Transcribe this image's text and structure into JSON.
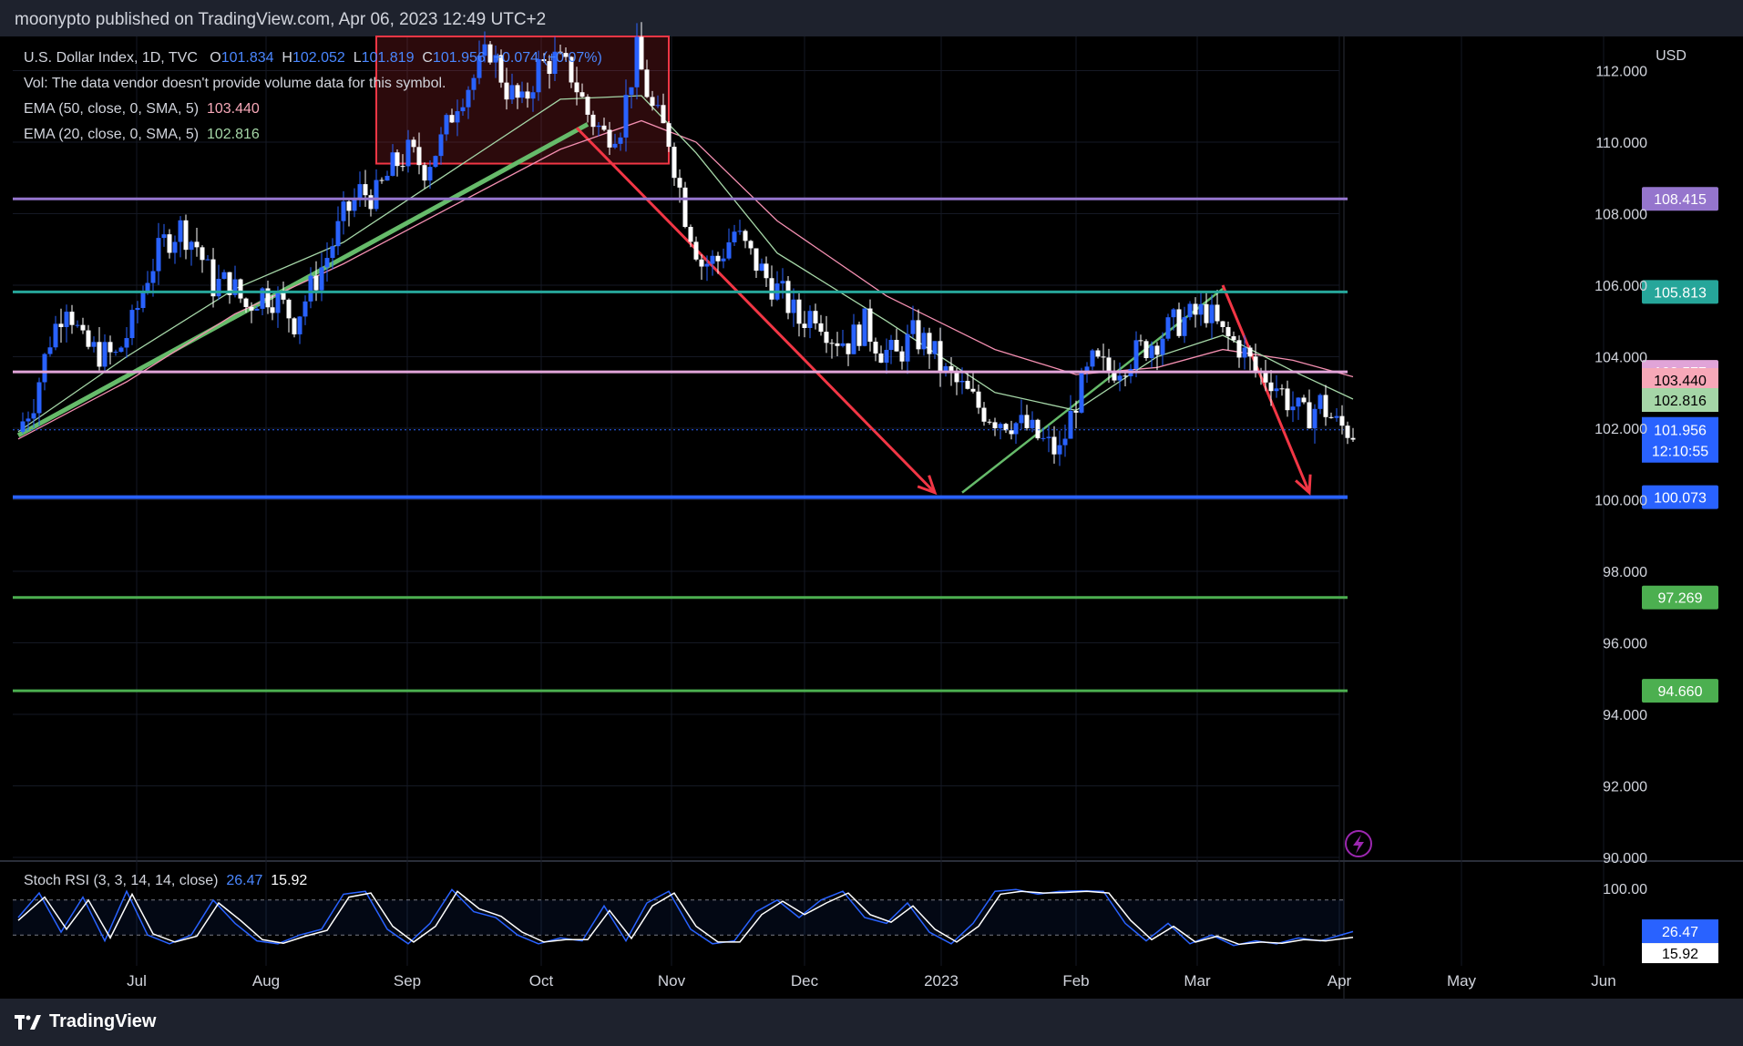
{
  "header": {
    "publisher": "moonypto published on TradingView.com, Apr 06, 2023 12:49 UTC+2"
  },
  "legend": {
    "symbol": "U.S. Dollar Index, 1D, TVC",
    "open_label": "O",
    "open": "101.834",
    "high_label": "H",
    "high": "102.052",
    "low_label": "L",
    "low": "101.819",
    "close_label": "C",
    "close": "101.956",
    "change": "+0.074 (+0.07%)",
    "vol_note": "Vol: The data vendor doesn't provide volume data for this symbol.",
    "ema50_label": "EMA (50, close, 0, SMA, 5)",
    "ema50_value": "103.440",
    "ema20_label": "EMA (20, close, 0, SMA, 5)",
    "ema20_value": "102.816"
  },
  "rsi": {
    "label": "Stoch RSI (3, 3, 14, 14, close)",
    "k_value": "26.47",
    "d_value": "15.92"
  },
  "footer": {
    "brand": "TradingView"
  },
  "colors": {
    "background": "#000000",
    "up": "#2962ff",
    "down": "#ffffff",
    "ema50": "#f48fb1",
    "ema20": "#a5d6a7",
    "stoch_k": "#2962ff",
    "stoch_d": "#ffffff",
    "level_purple": "#9575cd",
    "level_teal": "#26a69a",
    "level_pink": "#e1a4d8",
    "level_blue": "#2962ff",
    "level_green": "#4caf50",
    "arrow_red": "#f23645",
    "trend_green": "#66bb6a",
    "box_red": "#f23645"
  },
  "chart_data": {
    "type": "candlestick",
    "title": "U.S. Dollar Index, 1D, TVC",
    "currency": "USD",
    "y_ticks": [
      "112.000",
      "110.000",
      "108.000",
      "106.000",
      "104.000",
      "102.000",
      "100.000",
      "98.000",
      "96.000",
      "94.000",
      "92.000",
      "90.000"
    ],
    "y_tick_values": [
      112,
      110,
      108,
      106,
      104,
      102,
      100,
      98,
      96,
      94,
      92,
      90
    ],
    "ylim": [
      90,
      113
    ],
    "x_labels": [
      "Jul",
      "Aug",
      "Sep",
      "Oct",
      "Nov",
      "Dec",
      "2023",
      "Feb",
      "Mar",
      "Apr",
      "May",
      "Jun"
    ],
    "horizontal_levels": [
      {
        "value": 108.415,
        "label": "108.415",
        "color": "#9575cd"
      },
      {
        "value": 105.813,
        "label": "105.813",
        "color": "#26a69a"
      },
      {
        "value": 103.577,
        "label": "103.577",
        "color": "#e1a4d8"
      },
      {
        "value": 100.073,
        "label": "100.073",
        "color": "#2962ff"
      },
      {
        "value": 97.269,
        "label": "97.269",
        "color": "#4caf50"
      },
      {
        "value": 94.66,
        "label": "94.660",
        "color": "#4caf50"
      }
    ],
    "price_badges": [
      {
        "label": "103.440",
        "color": "#f7a8b8"
      },
      {
        "label": "102.816",
        "color": "#a5d6a7"
      },
      {
        "label": "101.956",
        "color": "#2962ff"
      },
      {
        "label": "12:10:55",
        "color": "#2962ff"
      }
    ],
    "last_price": 101.956,
    "countdown": "12:10:55",
    "ema50_last": 103.44,
    "ema20_last": 102.816,
    "rsi_ticks": [
      "100.00"
    ],
    "rsi_k_last": 26.47,
    "rsi_d_last": 15.92,
    "close_path": [
      [
        0,
        101.9
      ],
      [
        3,
        102.8
      ],
      [
        6,
        104.5
      ],
      [
        9,
        105.6
      ],
      [
        12,
        104.3
      ],
      [
        15,
        104.1
      ],
      [
        18,
        104.0
      ],
      [
        21,
        104.9
      ],
      [
        24,
        106.3
      ],
      [
        27,
        107.2
      ],
      [
        30,
        107.6
      ],
      [
        33,
        107.1
      ],
      [
        36,
        106.0
      ],
      [
        39,
        106.1
      ],
      [
        42,
        105.4
      ],
      [
        45,
        105.8
      ],
      [
        48,
        105.6
      ],
      [
        51,
        105.0
      ],
      [
        54,
        105.9
      ],
      [
        57,
        106.8
      ],
      [
        60,
        107.9
      ],
      [
        63,
        108.6
      ],
      [
        66,
        108.5
      ],
      [
        69,
        109.3
      ],
      [
        72,
        109.7
      ],
      [
        75,
        109.3
      ],
      [
        78,
        110.0
      ],
      [
        81,
        111.2
      ],
      [
        84,
        111.8
      ],
      [
        87,
        112.6
      ],
      [
        90,
        111.5
      ],
      [
        93,
        111.0
      ],
      [
        96,
        112.1
      ],
      [
        99,
        112.3
      ],
      [
        102,
        111.9
      ],
      [
        105,
        110.8
      ],
      [
        108,
        110.2
      ],
      [
        111,
        110.5
      ],
      [
        114,
        112.5
      ],
      [
        117,
        110.9
      ],
      [
        120,
        110.1
      ],
      [
        123,
        108.0
      ],
      [
        126,
        106.6
      ],
      [
        129,
        106.7
      ],
      [
        132,
        107.5
      ],
      [
        135,
        106.8
      ],
      [
        138,
        106.2
      ],
      [
        141,
        105.7
      ],
      [
        144,
        105.0
      ],
      [
        147,
        105.3
      ],
      [
        150,
        104.6
      ],
      [
        153,
        104.4
      ],
      [
        156,
        104.9
      ],
      [
        159,
        104.2
      ],
      [
        162,
        104.0
      ],
      [
        165,
        104.6
      ],
      [
        168,
        104.3
      ],
      [
        171,
        103.5
      ],
      [
        174,
        103.1
      ],
      [
        177,
        102.6
      ],
      [
        180,
        102.3
      ],
      [
        183,
        102.2
      ],
      [
        186,
        102.0
      ],
      [
        189,
        101.6
      ],
      [
        192,
        101.3
      ],
      [
        195,
        102.8
      ],
      [
        198,
        103.8
      ],
      [
        201,
        103.6
      ],
      [
        204,
        103.9
      ],
      [
        207,
        104.2
      ],
      [
        210,
        104.5
      ],
      [
        213,
        104.9
      ],
      [
        216,
        105.1
      ],
      [
        219,
        105.3
      ],
      [
        222,
        104.6
      ],
      [
        225,
        104.3
      ],
      [
        228,
        103.6
      ],
      [
        231,
        103.4
      ],
      [
        234,
        102.8
      ],
      [
        237,
        102.3
      ],
      [
        240,
        102.7
      ],
      [
        243,
        102.1
      ],
      [
        246,
        101.9
      ]
    ],
    "ema50_path": [
      [
        0,
        101.7
      ],
      [
        20,
        103.3
      ],
      [
        40,
        105.2
      ],
      [
        60,
        106.6
      ],
      [
        80,
        108.2
      ],
      [
        100,
        109.8
      ],
      [
        115,
        110.6
      ],
      [
        125,
        110.0
      ],
      [
        140,
        107.8
      ],
      [
        160,
        105.7
      ],
      [
        180,
        104.2
      ],
      [
        195,
        103.5
      ],
      [
        210,
        103.7
      ],
      [
        222,
        104.2
      ],
      [
        235,
        103.9
      ],
      [
        246,
        103.44
      ]
    ],
    "ema20_path": [
      [
        0,
        101.9
      ],
      [
        20,
        104.0
      ],
      [
        40,
        105.9
      ],
      [
        60,
        107.2
      ],
      [
        80,
        109.2
      ],
      [
        100,
        111.2
      ],
      [
        115,
        111.3
      ],
      [
        125,
        109.7
      ],
      [
        140,
        106.9
      ],
      [
        160,
        105.0
      ],
      [
        180,
        103.0
      ],
      [
        195,
        102.5
      ],
      [
        210,
        104.0
      ],
      [
        222,
        104.6
      ],
      [
        235,
        103.6
      ],
      [
        246,
        102.816
      ]
    ],
    "annotations": [
      {
        "type": "box",
        "label": "",
        "range": [
          [
            66,
            113.0
          ],
          [
            120,
            109.4
          ]
        ]
      },
      {
        "type": "trendline",
        "points": [
          [
            0,
            101.8
          ],
          [
            105,
            110.5
          ]
        ]
      },
      {
        "type": "arrow",
        "points": [
          [
            103,
            110.4
          ],
          [
            169,
            100.2
          ]
        ]
      },
      {
        "type": "trendline",
        "points": [
          [
            174,
            100.2
          ],
          [
            222,
            105.9
          ]
        ]
      },
      {
        "type": "arrow",
        "points": [
          [
            222,
            106.0
          ],
          [
            238,
            100.2
          ]
        ]
      }
    ],
    "rsi_k_path": [
      [
        0,
        50
      ],
      [
        4,
        92
      ],
      [
        8,
        25
      ],
      [
        12,
        85
      ],
      [
        16,
        10
      ],
      [
        20,
        95
      ],
      [
        24,
        20
      ],
      [
        28,
        5
      ],
      [
        32,
        20
      ],
      [
        36,
        80
      ],
      [
        40,
        40
      ],
      [
        44,
        10
      ],
      [
        48,
        5
      ],
      [
        52,
        20
      ],
      [
        56,
        30
      ],
      [
        60,
        90
      ],
      [
        64,
        95
      ],
      [
        68,
        30
      ],
      [
        72,
        5
      ],
      [
        76,
        40
      ],
      [
        80,
        98
      ],
      [
        84,
        60
      ],
      [
        88,
        50
      ],
      [
        92,
        20
      ],
      [
        96,
        5
      ],
      [
        100,
        15
      ],
      [
        104,
        10
      ],
      [
        108,
        70
      ],
      [
        112,
        10
      ],
      [
        116,
        75
      ],
      [
        120,
        95
      ],
      [
        124,
        30
      ],
      [
        128,
        5
      ],
      [
        132,
        10
      ],
      [
        136,
        60
      ],
      [
        140,
        80
      ],
      [
        144,
        50
      ],
      [
        148,
        80
      ],
      [
        152,
        95
      ],
      [
        156,
        50
      ],
      [
        160,
        40
      ],
      [
        164,
        75
      ],
      [
        168,
        25
      ],
      [
        172,
        5
      ],
      [
        176,
        40
      ],
      [
        180,
        95
      ],
      [
        184,
        98
      ],
      [
        188,
        90
      ],
      [
        192,
        95
      ],
      [
        196,
        96
      ],
      [
        200,
        95
      ],
      [
        204,
        40
      ],
      [
        208,
        10
      ],
      [
        212,
        40
      ],
      [
        216,
        5
      ],
      [
        220,
        20
      ],
      [
        224,
        2
      ],
      [
        228,
        10
      ],
      [
        232,
        5
      ],
      [
        236,
        15
      ],
      [
        240,
        10
      ],
      [
        246,
        26
      ]
    ],
    "rsi_d_path": [
      [
        0,
        45
      ],
      [
        5,
        85
      ],
      [
        9,
        30
      ],
      [
        13,
        80
      ],
      [
        17,
        15
      ],
      [
        21,
        90
      ],
      [
        25,
        22
      ],
      [
        29,
        8
      ],
      [
        33,
        18
      ],
      [
        37,
        75
      ],
      [
        41,
        45
      ],
      [
        45,
        12
      ],
      [
        49,
        6
      ],
      [
        53,
        18
      ],
      [
        57,
        28
      ],
      [
        61,
        85
      ],
      [
        65,
        92
      ],
      [
        69,
        35
      ],
      [
        73,
        8
      ],
      [
        77,
        35
      ],
      [
        81,
        95
      ],
      [
        85,
        65
      ],
      [
        89,
        52
      ],
      [
        93,
        25
      ],
      [
        97,
        8
      ],
      [
        101,
        12
      ],
      [
        105,
        12
      ],
      [
        109,
        62
      ],
      [
        113,
        14
      ],
      [
        117,
        70
      ],
      [
        121,
        92
      ],
      [
        125,
        35
      ],
      [
        129,
        8
      ],
      [
        133,
        8
      ],
      [
        137,
        55
      ],
      [
        141,
        78
      ],
      [
        145,
        55
      ],
      [
        149,
        75
      ],
      [
        153,
        92
      ],
      [
        157,
        55
      ],
      [
        161,
        42
      ],
      [
        165,
        70
      ],
      [
        169,
        30
      ],
      [
        173,
        8
      ],
      [
        177,
        35
      ],
      [
        181,
        90
      ],
      [
        185,
        95
      ],
      [
        189,
        92
      ],
      [
        193,
        93
      ],
      [
        197,
        95
      ],
      [
        201,
        92
      ],
      [
        205,
        45
      ],
      [
        209,
        12
      ],
      [
        213,
        35
      ],
      [
        217,
        8
      ],
      [
        221,
        18
      ],
      [
        225,
        4
      ],
      [
        229,
        8
      ],
      [
        233,
        6
      ],
      [
        237,
        12
      ],
      [
        241,
        10
      ],
      [
        246,
        16
      ]
    ]
  }
}
